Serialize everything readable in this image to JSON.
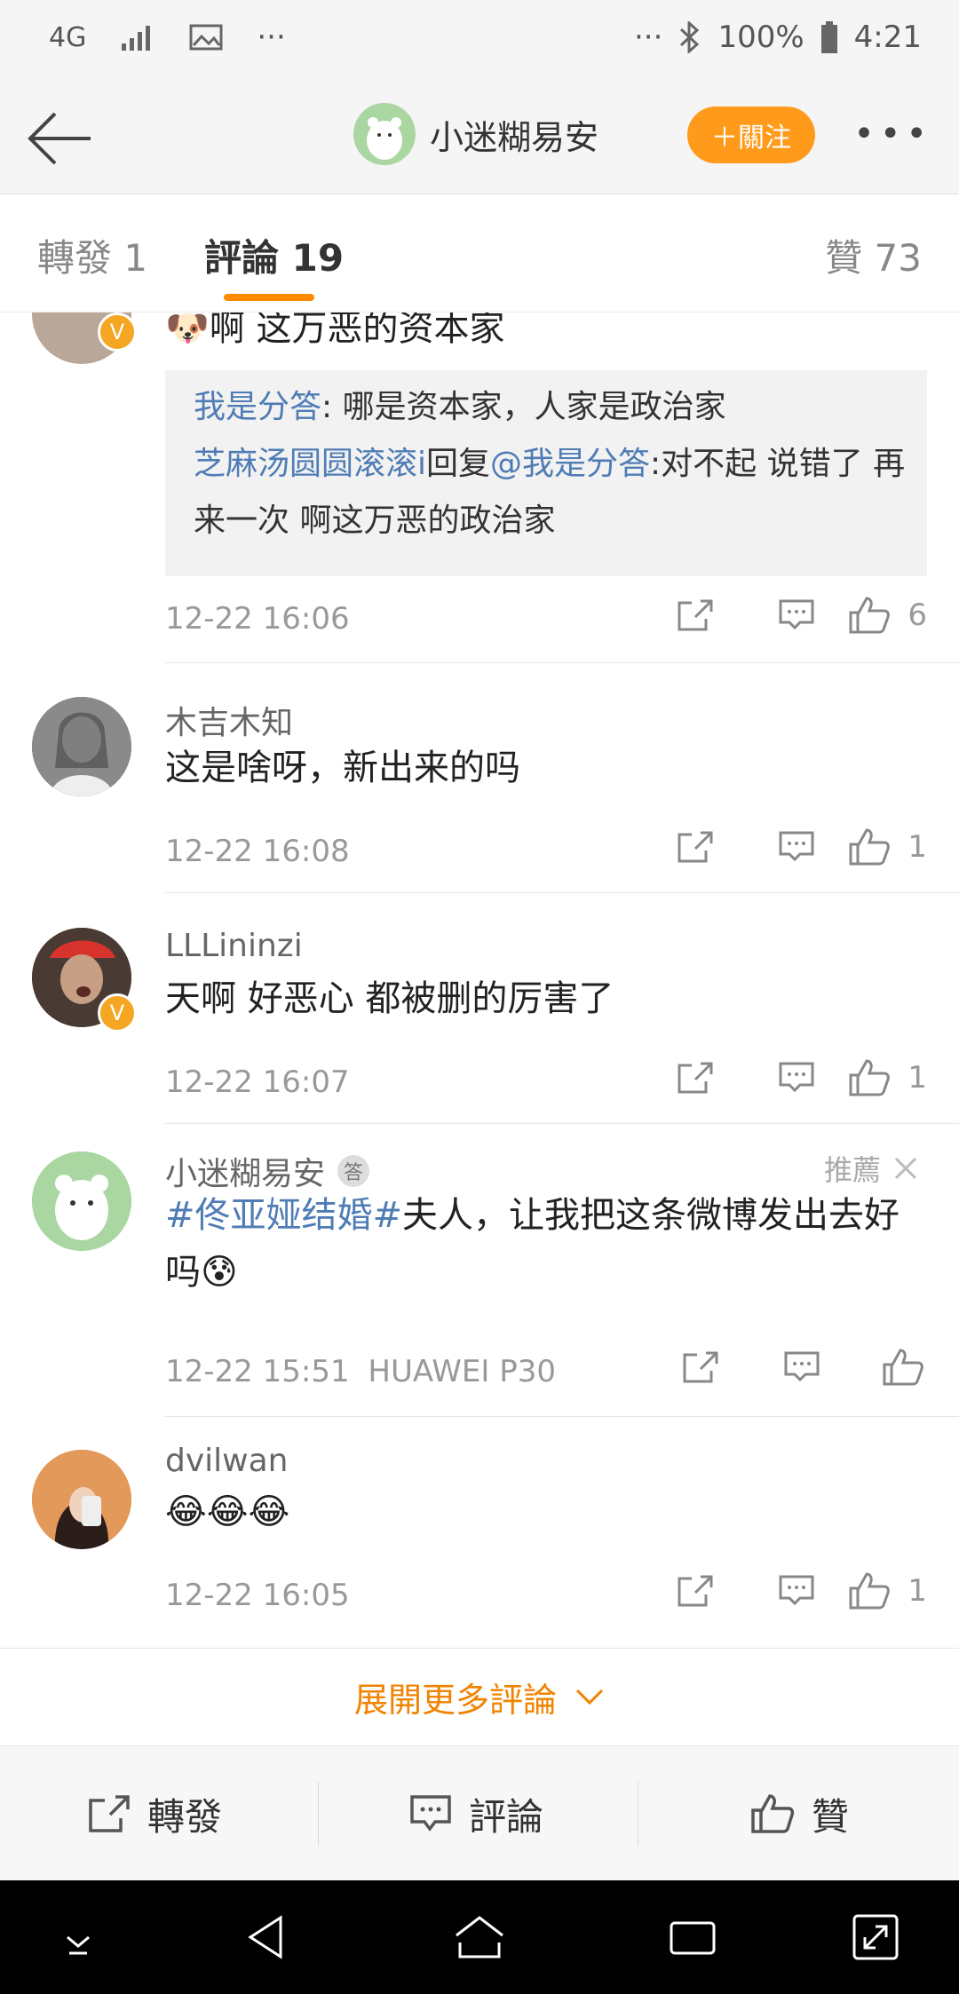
{
  "status_bar": {
    "network": "4G",
    "battery": "100%",
    "time": "4:21"
  },
  "header": {
    "title": "小迷糊易安",
    "follow_label": "＋關注"
  },
  "tabs": [
    {
      "label": "轉發 1"
    },
    {
      "label": "評論 19"
    },
    {
      "label": "贊 73"
    }
  ],
  "comments": [
    {
      "text": "啊 这万恶的资本家",
      "replies": [
        {
          "user": "我是分答",
          "sep": ": ",
          "text": "哪是资本家，人家是政治家"
        },
        {
          "user": "芝麻汤圆圆滚滚i",
          "mid": "回复",
          "mention": "@我是分答",
          "text": ":对不起 说错了  再来一次 啊这万恶的政治家"
        }
      ],
      "time": "12-22 16:06",
      "likes": "6"
    },
    {
      "name": "木吉木知",
      "text": "这是啥呀，新出来的吗",
      "time": "12-22 16:08",
      "likes": "1"
    },
    {
      "name": "LLLininzi",
      "text": "天啊 好恶心 都被删的厉害了",
      "time": "12-22 16:07",
      "likes": "1"
    },
    {
      "name": "小迷糊易安",
      "badge": "答",
      "recommend": "推薦",
      "topic": "#佟亚娅结婚#",
      "text": "夫人，让我把这条微博发出去好吗",
      "time": "12-22 15:51",
      "device": "HUAWEI P30"
    },
    {
      "name": "dvilwan",
      "text": "😂😂😂",
      "time": "12-22 16:05",
      "likes": "1"
    }
  ],
  "expand_label": "展開更多評論",
  "bottom_bar": {
    "repost": "轉發",
    "comment": "評論",
    "like": "贊"
  },
  "colors": {
    "accent": "#ff8a00",
    "follow": "#ff9a1a",
    "link": "#4f7cb5"
  }
}
